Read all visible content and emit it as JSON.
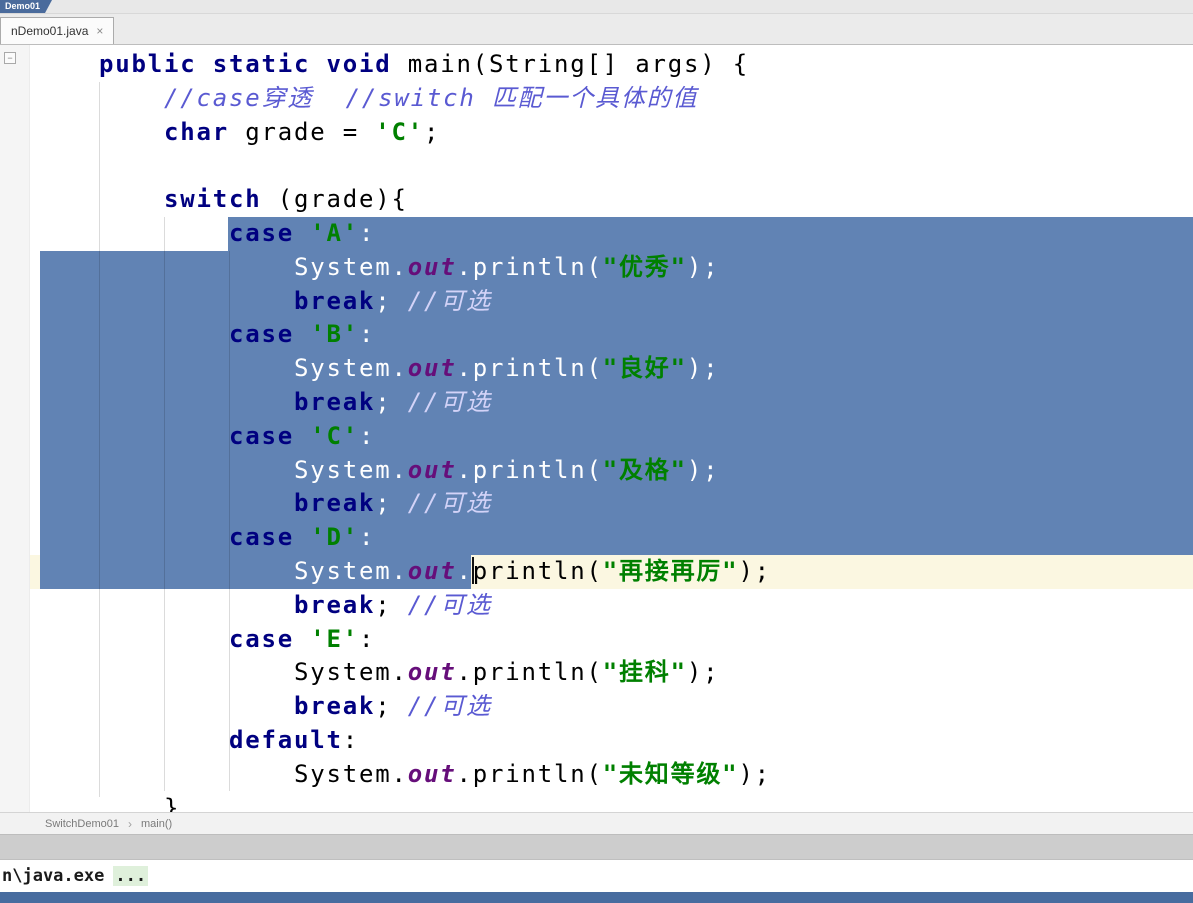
{
  "colors": {
    "selection": "#6183B4",
    "current_line": "#FBF7E1",
    "keyword": "#000080",
    "string": "#008000",
    "static_field": "#660E7A",
    "comment": "#5A5AD2",
    "bottom_bar": "#476C9F"
  },
  "icons": {
    "tab_close": "×",
    "crumb_separator": "›",
    "fold": "−"
  },
  "navbar": {
    "crumb": "Demo01"
  },
  "tabbar": {
    "tab_label": "nDemo01.java"
  },
  "breadcrumbs": {
    "class_name": "SwitchDemo01",
    "method_name": "main()"
  },
  "console": {
    "prefix": "n\\java.exe",
    "ellipsis": "..."
  },
  "editor": {
    "lines": [
      {
        "bg": "none",
        "tokens": [
          [
            "plain",
            "    "
          ],
          [
            "kw",
            "public"
          ],
          [
            "plain",
            " "
          ],
          [
            "kw",
            "static"
          ],
          [
            "plain",
            " "
          ],
          [
            "kw",
            "void"
          ],
          [
            "plain",
            " main(String[] args) {"
          ]
        ]
      },
      {
        "bg": "none",
        "tokens": [
          [
            "plain",
            "        "
          ],
          [
            "comment",
            "//case穿透  //switch 匹配一个具体的值"
          ]
        ]
      },
      {
        "bg": "none",
        "tokens": [
          [
            "plain",
            "        "
          ],
          [
            "kw",
            "char"
          ],
          [
            "plain",
            " grade = "
          ],
          [
            "str",
            "'C'"
          ],
          [
            "plain",
            ";"
          ]
        ]
      },
      {
        "bg": "none",
        "tokens": [
          [
            "plain",
            ""
          ]
        ]
      },
      {
        "bg": "none",
        "tokens": [
          [
            "plain",
            "        "
          ],
          [
            "kw",
            "switch"
          ],
          [
            "plain",
            " (grade){"
          ]
        ]
      },
      {
        "bg": "fromtext",
        "tokens": [
          [
            "plain",
            "            ",
            true
          ],
          [
            "kw",
            "case",
            true
          ],
          [
            "plain",
            " ",
            true
          ],
          [
            "str",
            "'A'",
            true
          ],
          [
            "plain",
            ":",
            true
          ]
        ]
      },
      {
        "bg": "full",
        "tokens": [
          [
            "plain",
            "                System.",
            true
          ],
          [
            "field",
            "out",
            true
          ],
          [
            "plain",
            ".println(",
            true
          ],
          [
            "str",
            "\"优秀\"",
            true
          ],
          [
            "plain",
            ");",
            true
          ]
        ]
      },
      {
        "bg": "full",
        "tokens": [
          [
            "plain",
            "                ",
            true
          ],
          [
            "kw",
            "break",
            true
          ],
          [
            "plain",
            "; ",
            true
          ],
          [
            "comment",
            "//可选",
            true
          ]
        ]
      },
      {
        "bg": "full",
        "tokens": [
          [
            "plain",
            "            ",
            true
          ],
          [
            "kw",
            "case",
            true
          ],
          [
            "plain",
            " ",
            true
          ],
          [
            "str",
            "'B'",
            true
          ],
          [
            "plain",
            ":",
            true
          ]
        ]
      },
      {
        "bg": "full",
        "tokens": [
          [
            "plain",
            "                System.",
            true
          ],
          [
            "field",
            "out",
            true
          ],
          [
            "plain",
            ".println(",
            true
          ],
          [
            "str",
            "\"良好\"",
            true
          ],
          [
            "plain",
            ");",
            true
          ]
        ]
      },
      {
        "bg": "full",
        "tokens": [
          [
            "plain",
            "                ",
            true
          ],
          [
            "kw",
            "break",
            true
          ],
          [
            "plain",
            "; ",
            true
          ],
          [
            "comment",
            "//可选",
            true
          ]
        ]
      },
      {
        "bg": "full",
        "tokens": [
          [
            "plain",
            "            ",
            true
          ],
          [
            "kw",
            "case",
            true
          ],
          [
            "plain",
            " ",
            true
          ],
          [
            "str",
            "'C'",
            true
          ],
          [
            "plain",
            ":",
            true
          ]
        ]
      },
      {
        "bg": "full",
        "tokens": [
          [
            "plain",
            "                System.",
            true
          ],
          [
            "field",
            "out",
            true
          ],
          [
            "plain",
            ".println(",
            true
          ],
          [
            "str",
            "\"及格\"",
            true
          ],
          [
            "plain",
            ");",
            true
          ]
        ]
      },
      {
        "bg": "full",
        "tokens": [
          [
            "plain",
            "                ",
            true
          ],
          [
            "kw",
            "break",
            true
          ],
          [
            "plain",
            "; ",
            true
          ],
          [
            "comment",
            "//可选",
            true
          ]
        ]
      },
      {
        "bg": "full",
        "tokens": [
          [
            "plain",
            "            ",
            true
          ],
          [
            "kw",
            "case",
            true
          ],
          [
            "plain",
            " ",
            true
          ],
          [
            "str",
            "'D'",
            true
          ],
          [
            "plain",
            ":",
            true
          ]
        ]
      },
      {
        "bg": "caretline",
        "tokens": [
          [
            "plain",
            "                System.",
            true
          ],
          [
            "field",
            "out",
            true
          ],
          [
            "plain",
            ".",
            true
          ],
          [
            "caret",
            ""
          ],
          [
            "plain",
            "println("
          ],
          [
            "str",
            "\"再接再厉\""
          ],
          [
            "plain",
            ");"
          ]
        ]
      },
      {
        "bg": "none",
        "tokens": [
          [
            "plain",
            "                "
          ],
          [
            "kw",
            "break"
          ],
          [
            "plain",
            "; "
          ],
          [
            "comment",
            "//可选"
          ]
        ]
      },
      {
        "bg": "none",
        "tokens": [
          [
            "plain",
            "            "
          ],
          [
            "kw",
            "case"
          ],
          [
            "plain",
            " "
          ],
          [
            "str",
            "'E'"
          ],
          [
            "plain",
            ":"
          ]
        ]
      },
      {
        "bg": "none",
        "tokens": [
          [
            "plain",
            "                System."
          ],
          [
            "field",
            "out"
          ],
          [
            "plain",
            ".println("
          ],
          [
            "str",
            "\"挂科\""
          ],
          [
            "plain",
            ");"
          ]
        ]
      },
      {
        "bg": "none",
        "tokens": [
          [
            "plain",
            "                "
          ],
          [
            "kw",
            "break"
          ],
          [
            "plain",
            "; "
          ],
          [
            "comment",
            "//可选"
          ]
        ]
      },
      {
        "bg": "none",
        "tokens": [
          [
            "plain",
            "            "
          ],
          [
            "kw",
            "default"
          ],
          [
            "plain",
            ":"
          ]
        ]
      },
      {
        "bg": "none",
        "tokens": [
          [
            "plain",
            "                System."
          ],
          [
            "field",
            "out"
          ],
          [
            "plain",
            ".println("
          ],
          [
            "str",
            "\"未知等级\""
          ],
          [
            "plain",
            ");"
          ]
        ]
      },
      {
        "bg": "none",
        "tokens": [
          [
            "plain",
            "        }"
          ]
        ]
      }
    ]
  }
}
